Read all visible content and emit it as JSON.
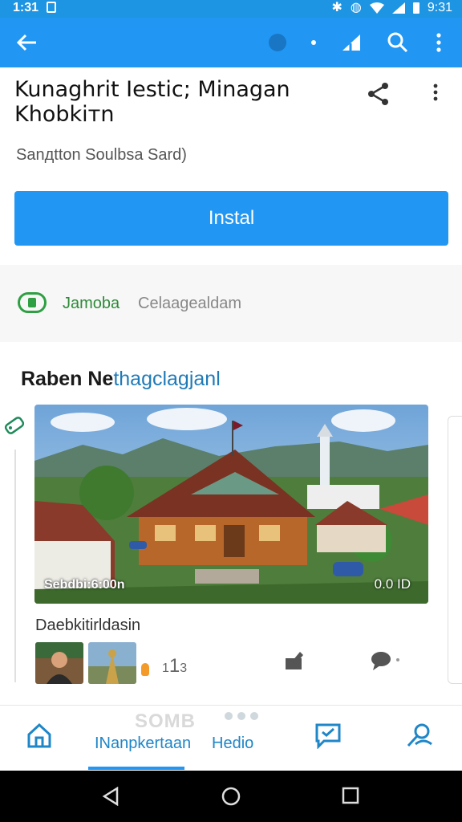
{
  "status_bar": {
    "left_time": "1:31",
    "right_time": "9:31",
    "icons": [
      "sim-icon",
      "bluetooth-icon",
      "alarm-icon",
      "wifi-icon",
      "signal-icon",
      "battery-icon"
    ]
  },
  "app_bar": {
    "icons": [
      "back-arrow-icon",
      "dot-icon",
      "small-dot-icon",
      "signal-icon",
      "search-icon",
      "more-vert-icon"
    ]
  },
  "app": {
    "title": "Kunaghrit Iestic; Minagan Khobkiтn",
    "subtitle": "Sanдtton Soulbsa Sard)",
    "install_label": "Instal"
  },
  "developer": {
    "name": "Jamoba",
    "category": "Celaagealdam"
  },
  "section": {
    "title_main": "Raben Ne",
    "title_accent": "thagclagjanl"
  },
  "media": {
    "caption_left": "Sebdbi:6:00n",
    "caption_right": "0.0 ID",
    "label": "Daebkitirldasin",
    "count": "1",
    "count_prefix": "1",
    "count_suffix": "3"
  },
  "bottom_nav": {
    "ghost_text": "SOMB",
    "items": [
      {
        "label": "",
        "icon": "home-icon"
      },
      {
        "label": "INanpkertaan",
        "icon": ""
      },
      {
        "label": "Hedio",
        "icon": ""
      },
      {
        "label": "",
        "icon": "message-icon"
      },
      {
        "label": "",
        "icon": "person-search-icon"
      }
    ]
  },
  "colors": {
    "primary": "#2196f3",
    "status_bar": "#1e95e2",
    "developer_green": "#2e8b3a",
    "accent_text": "#1f7ab8"
  }
}
